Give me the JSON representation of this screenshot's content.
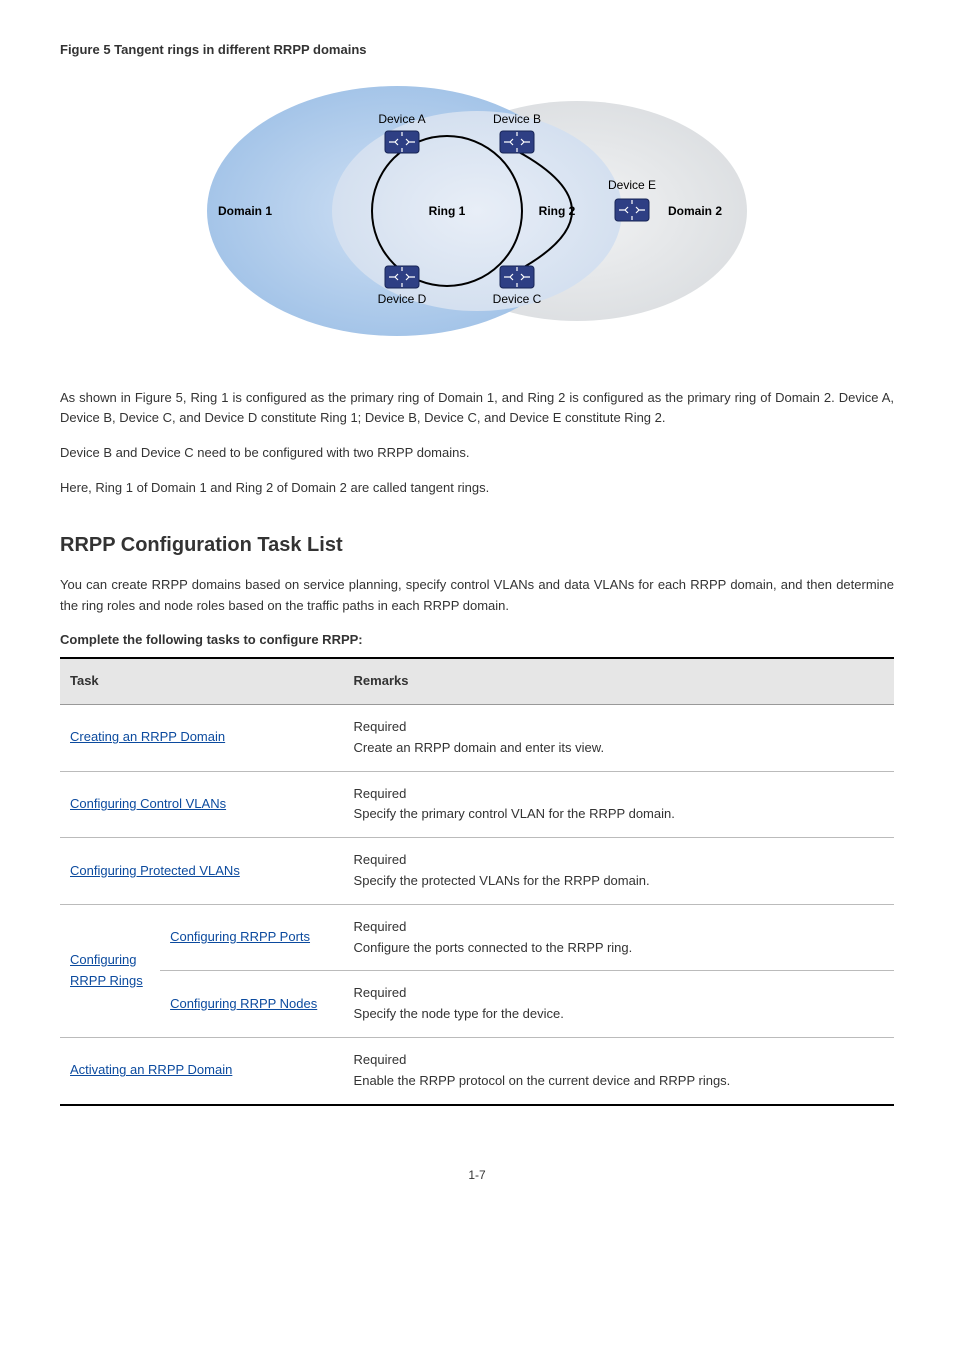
{
  "figure": {
    "caption": "Figure 5 Tangent rings in different RRPP domains",
    "domain1": "Domain 1",
    "domain2": "Domain 2",
    "ring1": "Ring 1",
    "ring2": "Ring 2",
    "devA": "Device A",
    "devB": "Device B",
    "devC": "Device C",
    "devD": "Device D",
    "devE": "Device E"
  },
  "para1": "As shown in Figure 5, Ring 1 is configured as the primary ring of Domain 1, and Ring 2 is configured as the primary ring of Domain 2. Device A, Device B, Device C, and Device D constitute Ring 1; Device B, Device C, and Device E constitute Ring 2.",
  "para2": "Device B and Device C need to be configured with two RRPP domains.",
  "para3": "Here, Ring 1 of Domain 1 and Ring 2 of Domain 2 are called tangent rings.",
  "sectionTitle": "RRPP Configuration Task List",
  "para4": "You can create RRPP domains based on service planning, specify control VLANs and data VLANs for each RRPP domain, and then determine the ring roles and node roles based on the traffic paths in each RRPP domain.",
  "tableCaption": "Complete the following tasks to configure RRPP:",
  "table": {
    "headers": [
      "Task",
      "Remarks"
    ],
    "rows": [
      {
        "task_link": "Creating an RRPP Domain",
        "task_rest": "",
        "remarks": "Required\nCreate an RRPP domain and enter its view."
      },
      {
        "task_link": "Configuring Control VLANs",
        "task_rest": "",
        "remarks": "Required\nSpecify the primary control VLAN for the RRPP domain."
      },
      {
        "task_link": "Configuring Protected VLANs",
        "task_rest": "",
        "remarks": "Required\nSpecify the protected VLANs for the RRPP domain."
      },
      {
        "group_link": "Configuring RRPP Rings",
        "sub_link": "Configuring RRPP Ports",
        "sub_rest": "",
        "remarks": "Required\nConfigure the ports connected to the RRPP ring."
      },
      {
        "group_cont": true,
        "sub_link": "Configuring RRPP Nodes",
        "sub_rest": "",
        "remarks": "Required\nSpecify the node type for the device."
      },
      {
        "task_link": "Activating an RRPP Domain",
        "task_rest": "",
        "remarks": "Required\nEnable the RRPP protocol on the current device and RRPP rings."
      }
    ]
  },
  "pageNumber": "1-7"
}
